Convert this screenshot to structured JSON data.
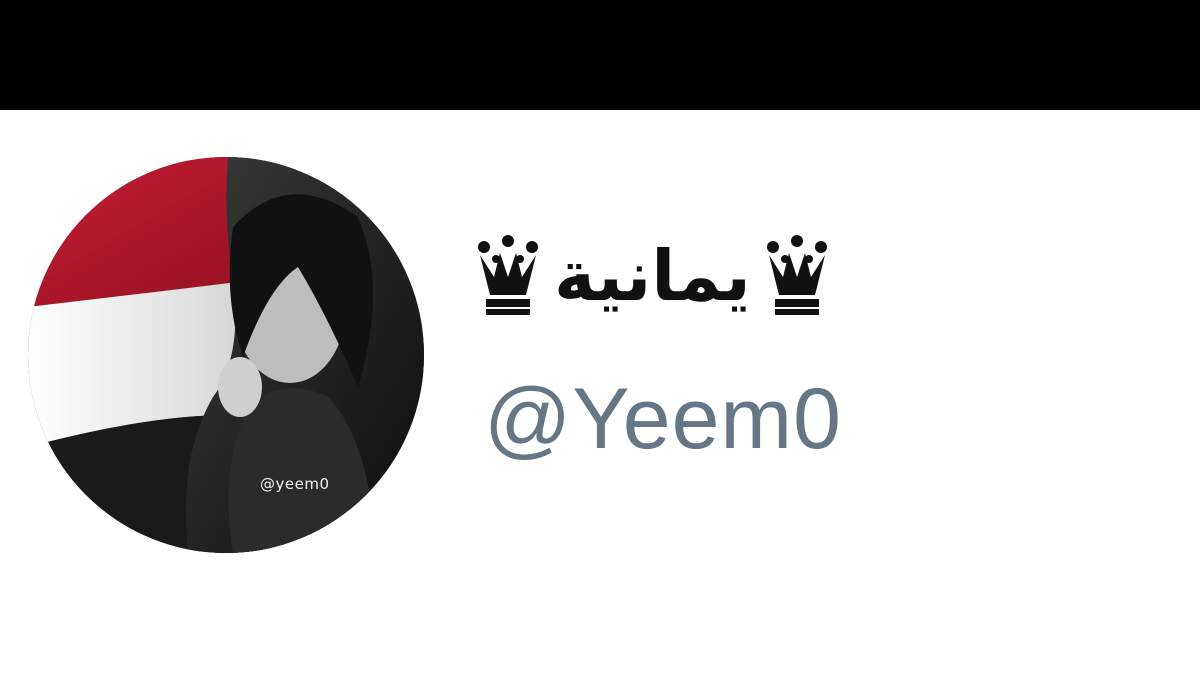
{
  "profile": {
    "display_name": "يمانية",
    "crown_symbol": "♛",
    "handle": "@Yeem0",
    "avatar_watermark": "@yeem0",
    "avatar_icon": "profile-photo"
  },
  "colors": {
    "top_bar": "#000000",
    "background": "#ffffff",
    "name_text": "#111111",
    "handle_text": "#667685",
    "flag_red": "#b3172d",
    "flag_white": "#f4f4f4",
    "flag_black": "#1a1a1a"
  }
}
